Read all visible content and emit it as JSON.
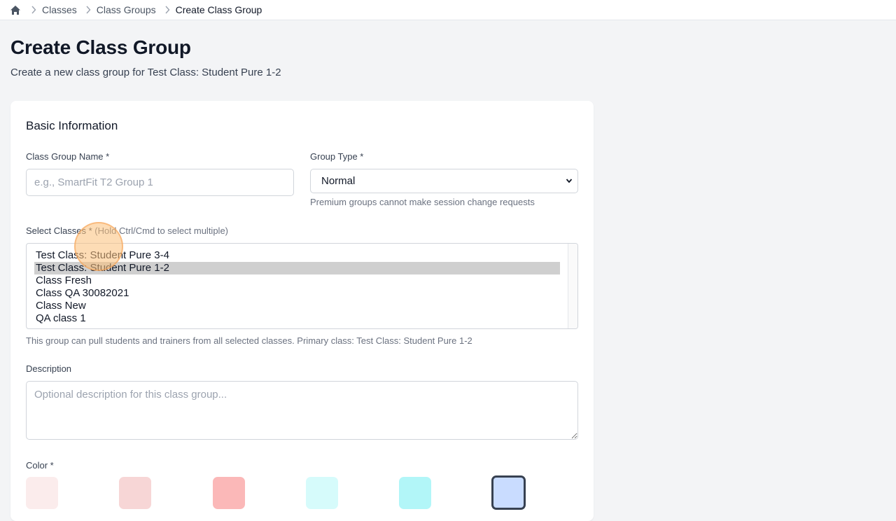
{
  "breadcrumb": {
    "items": [
      "Classes",
      "Class Groups"
    ],
    "current": "Create Class Group"
  },
  "page": {
    "title": "Create Class Group",
    "subtitle": "Create a new class group for Test Class: Student Pure 1-2"
  },
  "form": {
    "section_title": "Basic Information",
    "group_name": {
      "label": "Class Group Name *",
      "placeholder": "e.g., SmartFit T2 Group 1",
      "value": ""
    },
    "group_type": {
      "label": "Group Type *",
      "selected": "Normal",
      "help": "Premium groups cannot make session change requests"
    },
    "classes": {
      "label": "Select Classes *",
      "hint": "(Hold Ctrl/Cmd to select multiple)",
      "options": [
        "Test Class: Student Pure 3-4",
        "Test Class: Student Pure 1-2",
        "Class Fresh",
        "Class QA 30082021",
        "Class New",
        "QA class 1"
      ],
      "selected_index": 1,
      "help": "This group can pull students and trainers from all selected classes. Primary class: Test Class: Student Pure 1-2"
    },
    "description": {
      "label": "Description",
      "placeholder": "Optional description for this class group..."
    },
    "color": {
      "label": "Color *",
      "swatches": [
        "#fbecec",
        "#f7d6d6",
        "#fbb8b8",
        "#d6fbfb",
        "#b2f6f8",
        "#c9dcff"
      ],
      "selected_index": 5
    }
  },
  "icons": {
    "home": "home-icon",
    "separator": "chevron-right-icon",
    "dropdown": "chevron-down-icon"
  }
}
